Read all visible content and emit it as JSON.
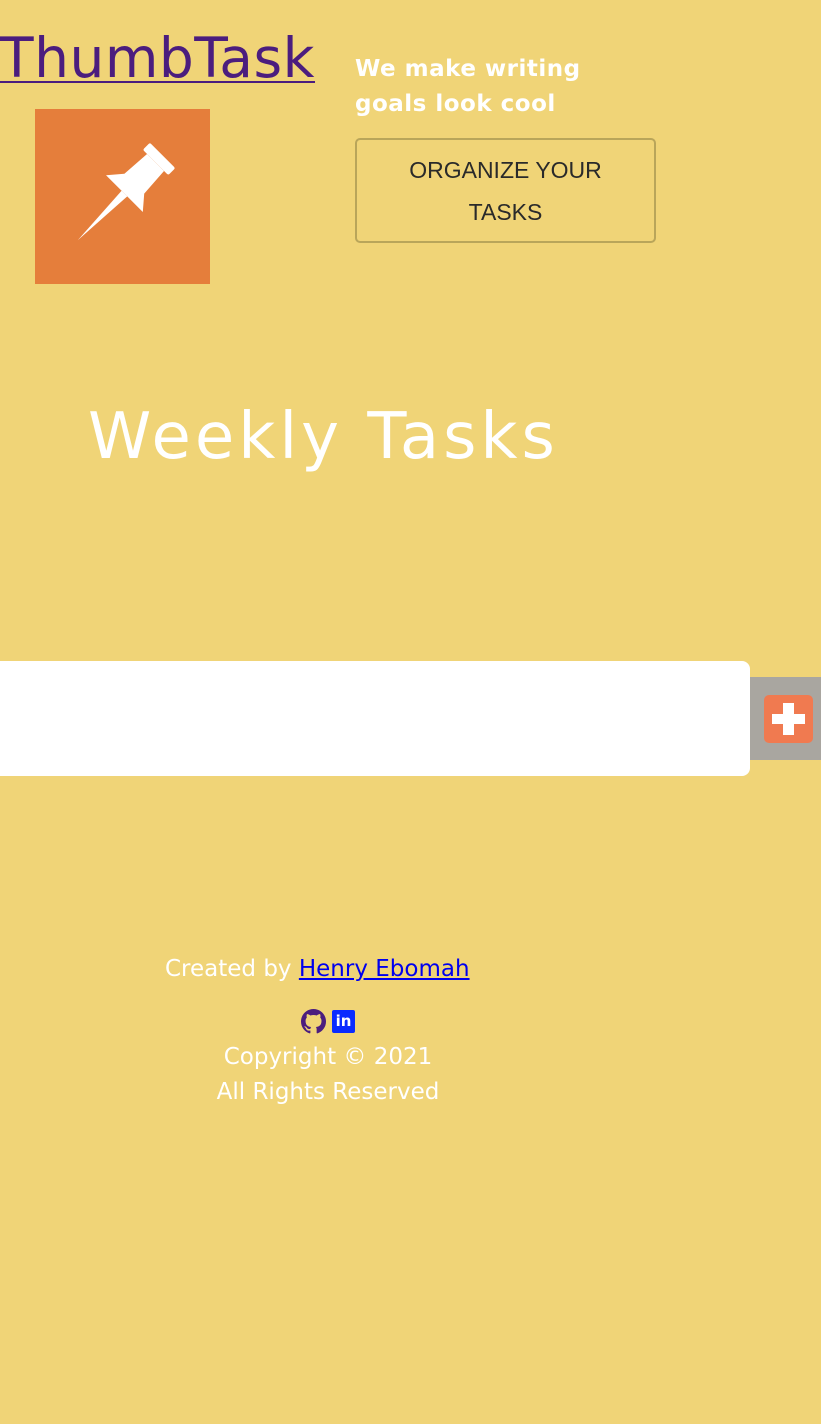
{
  "header": {
    "brand": "ThumbTask",
    "tagline": "We make writing goals look cool",
    "organize_button": "ORGANIZE YOUR TASKS",
    "logo_icon": "pushpin-icon"
  },
  "main": {
    "title": "Weekly Tasks",
    "task_input": {
      "value": "",
      "placeholder": ""
    },
    "add_button_icon": "plus-icon"
  },
  "footer": {
    "created_by": "Created by",
    "author": "Henry Ebomah",
    "social": [
      {
        "icon": "github-icon"
      },
      {
        "icon": "linkedin-icon",
        "text": "in"
      }
    ],
    "copyright": "Copyright © 2021",
    "rights": "All Rights Reserved"
  },
  "colors": {
    "background": "#f0d477",
    "brand": "#4b1d7e",
    "logo_bg": "#e57e3b",
    "add_button": "#f07a50",
    "add_panel": "#a9a6a0",
    "link": "#0000ee",
    "linkedin": "#0a2bff"
  }
}
